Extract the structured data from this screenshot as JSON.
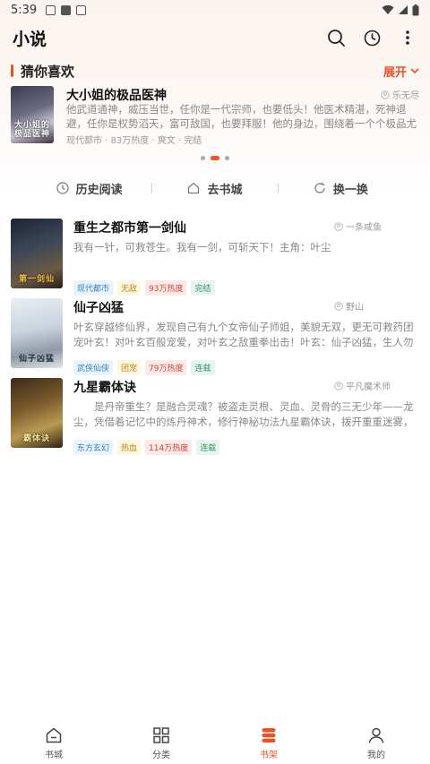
{
  "status_bar": {
    "time": "5:39"
  },
  "app": {
    "title": "小说"
  },
  "guess": {
    "title": "猜你喜欢",
    "expand_label": "展开",
    "featured": {
      "title": "大小姐的极品医神",
      "author": "乐无尽",
      "desc": "他武道通神，威压当世，任你是一代宗师，也要低头！他医术精湛，死神退避，任你是权势滔天，富可敌国，也要拜服！他的身边，围绕着一个个极品尤物，...",
      "meta": "现代都市 · 83万热度 · 爽文 · 完结",
      "cover_text": "大小姐的\n极品医神"
    },
    "carousel_total": 3,
    "carousel_active": 2
  },
  "quick_actions": {
    "history": "历史阅读",
    "store": "去书城",
    "refresh": "换一换"
  },
  "books": [
    {
      "title": "重生之都市第一剑仙",
      "author": "一条咸鱼",
      "desc": "我有一针，可救苍生。我有一剑，可斩天下！主角：叶尘",
      "tags": [
        "现代都市",
        "无敌",
        "93万热度",
        "完结"
      ],
      "cover_text": "第一剑仙"
    },
    {
      "title": "仙子凶猛",
      "author": "野山",
      "desc": "叶玄穿越修仙界，发现自己有九个女帝仙子师姐，美貌无双，更无可救药团宠叶玄！对叶玄百般宠爱，对叶玄之敌重拳出击！叶玄：仙子凶猛，生人勿近！",
      "tags": [
        "武侠仙侠",
        "团宠",
        "79万热度",
        "连载"
      ],
      "cover_text": "仙子凶猛"
    },
    {
      "title": "九星霸体诀",
      "author": "平凡魔术师",
      "desc": "　　是丹帝重生？是融合灵魂？被盗走灵根、灵血、灵骨的三无少年——龙尘，凭借着记忆中的炼丹神术，修行神秘功法九星霸体诀，拨开重重迷雾，解开...",
      "tags": [
        "东方玄幻",
        "热血",
        "114万热度",
        "连载"
      ],
      "cover_text": "霸体诀"
    }
  ],
  "bottom_nav": [
    {
      "label": "书城",
      "icon": "home-icon",
      "active": false
    },
    {
      "label": "分类",
      "icon": "grid-icon",
      "active": false
    },
    {
      "label": "书架",
      "icon": "bookshelf-icon",
      "active": true
    },
    {
      "label": "我的",
      "icon": "person-icon",
      "active": false
    }
  ],
  "colors": {
    "accent": "#e8542a",
    "text_primary": "#111111",
    "text_secondary": "#888888"
  }
}
